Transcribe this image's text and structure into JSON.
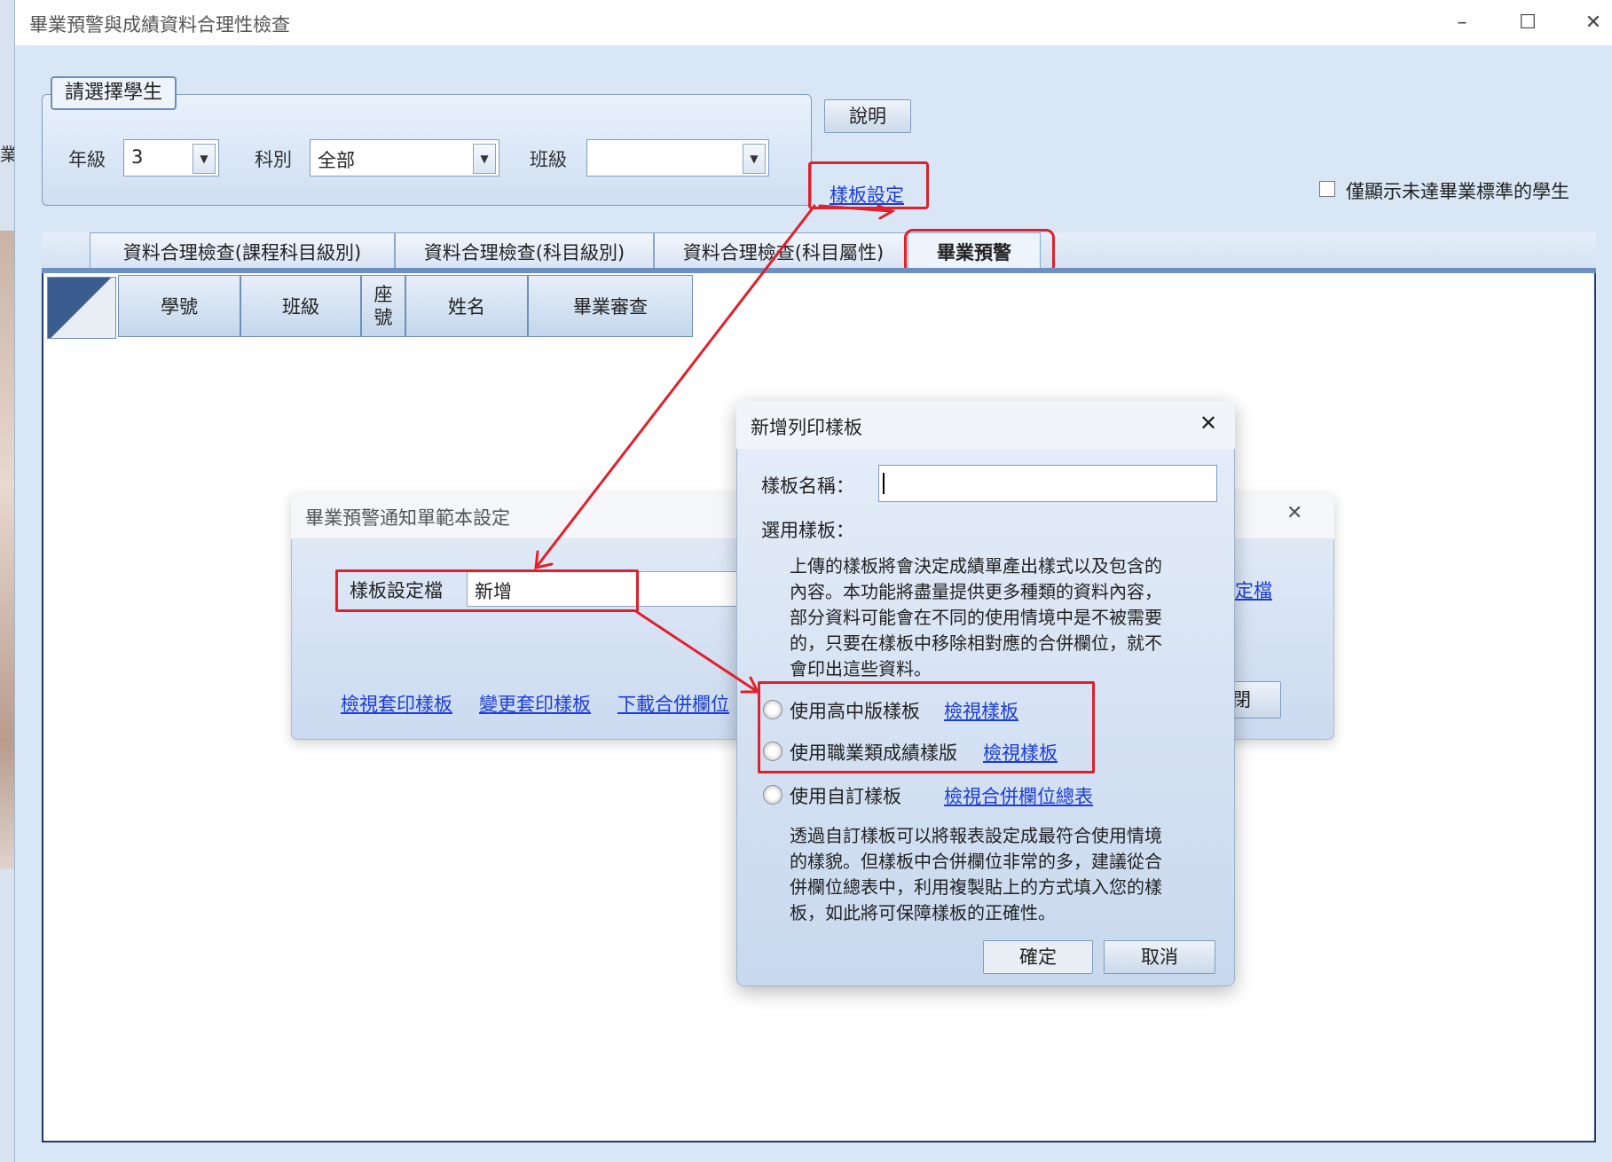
{
  "window": {
    "title": "畢業預警與成績資料合理性檢查",
    "minimize_icon": "minimize-icon",
    "maximize_icon": "maximize-icon",
    "close_icon": "close-icon"
  },
  "background": {
    "left_text": "業"
  },
  "student_group": {
    "title": "請選擇學生",
    "grade_label": "年級",
    "grade_value": "3",
    "dept_label": "科別",
    "dept_value": "全部",
    "class_label": "班級",
    "class_value": ""
  },
  "help_button": "說明",
  "template_settings_link": "樣板設定",
  "only_show_checkbox_label": "僅顯示未達畢業標準的學生",
  "tabs": [
    {
      "label": "資料合理檢查(課程科目級別)"
    },
    {
      "label": "資料合理檢查(科目級別)"
    },
    {
      "label": "資料合理檢查(科目屬性)"
    },
    {
      "label": "畢業預警"
    }
  ],
  "grid": {
    "columns": [
      "學號",
      "班級",
      "座號",
      "姓名",
      "畢業審查"
    ]
  },
  "dialog_template": {
    "title": "畢業預警通知單範本設定",
    "config_label": "樣板設定檔",
    "config_value": "新增",
    "link_view": "檢視套印樣板",
    "link_change": "變更套印樣板",
    "link_download": "下載合併欄位",
    "link_right_partial": "定檔",
    "button_right_partial": "閉",
    "close_icon": "close-icon"
  },
  "dialog_new": {
    "title": "新增列印樣板",
    "name_label": "樣板名稱：",
    "name_value": "",
    "apply_label": "選用樣板：",
    "description": "上傳的樣板將會決定成績單產出樣式以及包含的內容。本功能將盡量提供更多種類的資料內容，部分資料可能會在不同的使用情境中是不被需要的，只要在樣板中移除相對應的合併欄位，就不會印出這些資料。",
    "desc_lines": [
      "上傳的樣板將會決定成績單產出樣式以及包含的",
      "內容。本功能將盡量提供更多種類的資料內容，",
      "部分資料可能會在不同的使用情境中是不被需要",
      "的，只要在樣板中移除相對應的合併欄位，就不",
      "會印出這些資料。"
    ],
    "options": [
      {
        "label": "使用高中版樣板",
        "link": "檢視樣板"
      },
      {
        "label": "使用職業類成績樣版",
        "link": "檢視樣板"
      },
      {
        "label": "使用自訂樣板",
        "link": "檢視合併欄位總表"
      }
    ],
    "custom_lines": [
      "透過自訂樣板可以將報表設定成最符合使用情境",
      "的樣貌。但樣板中合併欄位非常的多，建議從合",
      "併欄位總表中，利用複製貼上的方式填入您的樣",
      "板，如此將可保障樣板的正確性。"
    ],
    "ok_button": "確定",
    "cancel_button": "取消",
    "close_icon": "close-icon"
  },
  "annotation_color": "#e0202a"
}
